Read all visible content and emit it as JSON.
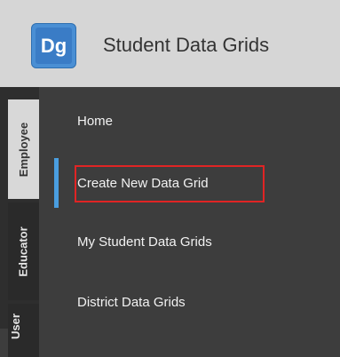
{
  "app": {
    "logo_text": "Dg",
    "title": "Student Data Grids"
  },
  "tabs": [
    {
      "label": "Employee",
      "active": true
    },
    {
      "label": "Educator",
      "active": false
    },
    {
      "label": "User",
      "active": false
    }
  ],
  "nav": {
    "items": [
      {
        "label": "Home"
      },
      {
        "label": "Create New Data Grid",
        "selected": true
      },
      {
        "label": "My Student Data Grids"
      },
      {
        "label": "District Data Grids"
      }
    ]
  },
  "colors": {
    "header_bg": "#d6d6d6",
    "nav_bg": "#3d3d3d",
    "accent": "#4a9ee0",
    "highlight": "#e02424",
    "logo": "#3a7cc6"
  }
}
